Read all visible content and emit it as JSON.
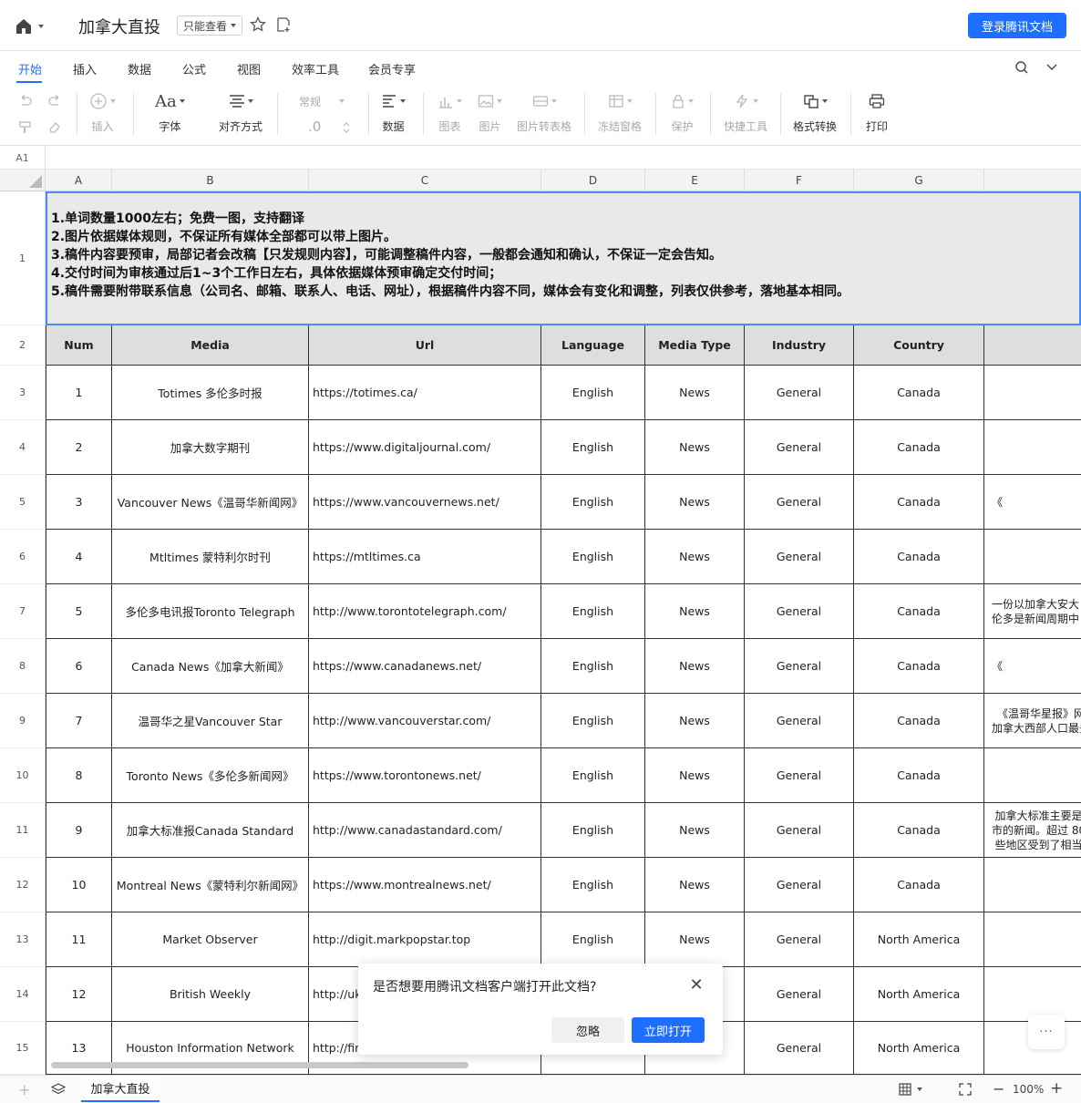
{
  "topbar": {
    "title": "加拿大直投",
    "readonly_label": "只能查看",
    "login_label": "登录腾讯文档"
  },
  "menu": {
    "tabs": [
      "开始",
      "插入",
      "数据",
      "公式",
      "视图",
      "效率工具",
      "会员专享"
    ],
    "active": "开始"
  },
  "toolbar": {
    "insert": "插入",
    "font": "字体",
    "align": "对齐方式",
    "number_format": "常规",
    "decimals": ".0",
    "data": "数据",
    "chart": "图表",
    "image": "图片",
    "image_to_table": "图片转表格",
    "freeze": "冻结窗格",
    "protect": "保护",
    "quick_tools": "快捷工具",
    "format_convert": "格式转换",
    "print": "打印"
  },
  "formula_bar": {
    "cell_ref": "A1"
  },
  "columns": [
    "A",
    "B",
    "C",
    "D",
    "E",
    "F",
    "G"
  ],
  "rows": [
    "1",
    "2",
    "3",
    "4",
    "5",
    "6",
    "7",
    "8",
    "9",
    "10",
    "11",
    "12",
    "13",
    "14",
    "15"
  ],
  "notes": [
    "1.单词数量1000左右；免费一图，支持翻译",
    "2.图片依据媒体规则，不保证所有媒体全部都可以带上图片。",
    "3.稿件内容要预审，局部记者会改稿【只发规则内容】，可能调整稿件内容，一般都会通知和确认，不保证一定会告知。",
    "4.交付时间为审核通过后1~3个工作日左右，具体依据媒体预审确定交付时间；",
    "5.稿件需要附带联系信息（公司名、邮箱、联系人、电话、网址），根据稿件内容不同，媒体会有变化和调整，列表仅供参考，落地基本相同。"
  ],
  "table": {
    "headers": [
      "Num",
      "Media",
      "Url",
      "Language",
      "Media Type",
      "Industry",
      "Country"
    ],
    "rows": [
      {
        "num": "1",
        "media": "Totimes 多伦多时报",
        "url": "https://totimes.ca/",
        "language": "English",
        "type": "News",
        "industry": "General",
        "country": "Canada",
        "extra": ""
      },
      {
        "num": "2",
        "media": "加拿大数字期刊",
        "url": "https://www.digitaljournal.com/",
        "language": "English",
        "type": "News",
        "industry": "General",
        "country": "Canada",
        "extra": ""
      },
      {
        "num": "3",
        "media": "Vancouver News《温哥华新闻网》",
        "url": "https://www.vancouvernews.net/",
        "language": "English",
        "type": "News",
        "industry": "General",
        "country": "Canada",
        "extra": "《"
      },
      {
        "num": "4",
        "media": "Mtltimes 蒙特利尔时刊",
        "url": "https://mtltimes.ca",
        "language": "English",
        "type": "News",
        "industry": "General",
        "country": "Canada",
        "extra": ""
      },
      {
        "num": "5",
        "media": "多伦多电讯报Toronto Telegraph",
        "url": "http://www.torontotelegraph.com/",
        "language": "English",
        "type": "News",
        "industry": "General",
        "country": "Canada",
        "extra": "一份以加拿大安大\n伦多是新闻周期中"
      },
      {
        "num": "6",
        "media": "Canada News《加拿大新闻》",
        "url": "https://www.canadanews.net/",
        "language": "English",
        "type": "News",
        "industry": "General",
        "country": "Canada",
        "extra": "《"
      },
      {
        "num": "7",
        "media": "温哥华之星Vancouver Star",
        "url": "http://www.vancouverstar.com/",
        "language": "English",
        "type": "News",
        "industry": "General",
        "country": "Canada",
        "extra": "《温哥华星报》网\n加拿大西部人口最多"
      },
      {
        "num": "8",
        "media": "Toronto News《多伦多新闻网》",
        "url": "https://www.torontonews.net/",
        "language": "English",
        "type": "News",
        "industry": "General",
        "country": "Canada",
        "extra": ""
      },
      {
        "num": "9",
        "media": "加拿大标准报Canada Standard",
        "url": "http://www.canadastandard.com/",
        "language": "English",
        "type": "News",
        "industry": "General",
        "country": "Canada",
        "extra": "加拿大标准主要是\n市的新闻。超过 80\n些地区受到了相当"
      },
      {
        "num": "10",
        "media": "Montreal News《蒙特利尔新闻网》",
        "url": "https://www.montrealnews.net/",
        "language": "English",
        "type": "News",
        "industry": "General",
        "country": "Canada",
        "extra": ""
      },
      {
        "num": "11",
        "media": "Market Observer",
        "url": "http://digit.markpopstar.top",
        "language": "English",
        "type": "News",
        "industry": "General",
        "country": "North America",
        "extra": ""
      },
      {
        "num": "12",
        "media": "British Weekly",
        "url": "http://uk",
        "language": "",
        "type": "",
        "industry": "General",
        "country": "North America",
        "extra": ""
      },
      {
        "num": "13",
        "media": "Houston Information Network",
        "url": "http://fin",
        "language": "",
        "type": "",
        "industry": "General",
        "country": "North America",
        "extra": ""
      }
    ]
  },
  "popup": {
    "message": "是否想要用腾讯文档客户端打开此文档?",
    "ignore": "忽略",
    "open": "立即打开"
  },
  "bottombar": {
    "sheet_name": "加拿大直投",
    "zoom": "100%"
  },
  "colors": {
    "accent": "#1e6fff",
    "header_fill": "#dedede",
    "notes_fill": "#e9e9e9",
    "selection": "#4a8af4"
  }
}
